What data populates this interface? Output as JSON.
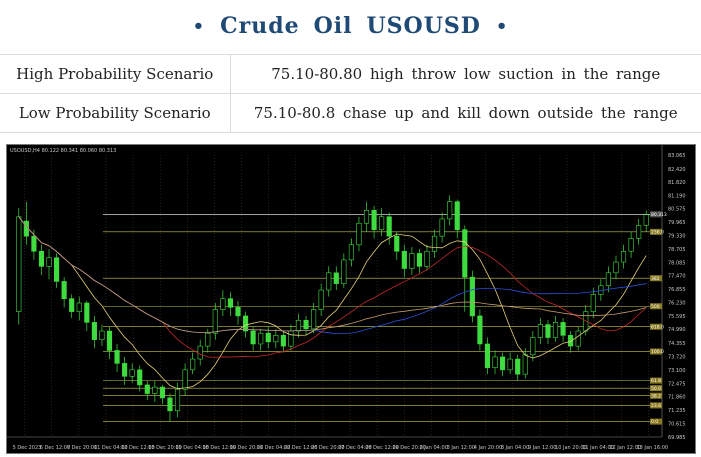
{
  "title": {
    "bullet_left": "•",
    "word1": "Crude",
    "word2": "Oil",
    "word3": "USOUSD",
    "bullet_right": "•"
  },
  "scenarios": [
    {
      "label": "High Probability Scenario",
      "value": "75.10-80.80 high throw low suction in the range"
    },
    {
      "label": "Low Probability Scenario",
      "value": "75.10-80.8 chase up and kill down outside the range"
    }
  ],
  "chart_data": {
    "type": "candlestick",
    "symbol_header": "USOUSD,H4  80.122 80.341 80.060 80.313",
    "price_axis": [
      "83.065",
      "82.420",
      "81.820",
      "81.190",
      "80.575",
      "79.965",
      "79.330",
      "78.705",
      "78.085",
      "77.470",
      "76.855",
      "76.230",
      "75.595",
      "74.990",
      "74.355",
      "73.720",
      "73.100",
      "72.475",
      "71.860",
      "71.235",
      "70.615",
      "69.985"
    ],
    "time_axis": [
      "5 Dec 2023",
      "6 Dec 12:00",
      "7 Dec 20:00",
      "11 Dec 04:00",
      "12 Dec 12:00",
      "13 Dec 20:00",
      "15 Dec 04:00",
      "18 Dec 12:00",
      "19 Dec 20:00",
      "21 Dec 04:00",
      "22 Dec 12:00",
      "26 Dec 20:00",
      "27 Dec 04:00",
      "28 Dec 12:00",
      "29 Dec 20:00",
      "2 Jan 04:00",
      "3 Jan 12:00",
      "4 Jan 20:00",
      "8 Jan 04:00",
      "9 Jan 12:00",
      "10 Jan 20:00",
      "11 Jan 04:00",
      "12 Jan 12:00",
      "13 Jan 16:00"
    ],
    "y_range": [
      69.985,
      83.065
    ],
    "current_price": "80.313",
    "levels": [
      {
        "price": 80.313,
        "label": "80.313",
        "color": "#ffffff"
      },
      {
        "price": 79.5,
        "label": "236.0",
        "color": "#c8c850"
      },
      {
        "price": 77.35,
        "label": "382",
        "color": "#c8c850"
      },
      {
        "price": 76.05,
        "label": "500",
        "color": "#c8c850"
      },
      {
        "price": 75.1,
        "label": "618.0",
        "color": "#c8c850"
      },
      {
        "price": 73.95,
        "label": "100.0",
        "color": "#c8c850"
      },
      {
        "price": 72.6,
        "label": "61.8",
        "color": "#c8c850"
      },
      {
        "price": 72.25,
        "label": "50.0",
        "color": "#c8c850"
      },
      {
        "price": 71.9,
        "label": "38.2",
        "color": "#c8c850"
      },
      {
        "price": 71.45,
        "label": "23.6",
        "color": "#c8c850"
      },
      {
        "price": 70.7,
        "label": "0.0",
        "color": "#c8c850"
      }
    ],
    "candles": [
      [
        75.8,
        80.2,
        75.2,
        80.6
      ],
      [
        80.0,
        79.3,
        78.9,
        80.9
      ],
      [
        79.3,
        78.6,
        78.2,
        79.6
      ],
      [
        78.6,
        77.9,
        77.5,
        78.9
      ],
      [
        77.9,
        78.3,
        77.3,
        78.7
      ],
      [
        78.3,
        77.2,
        76.9,
        78.5
      ],
      [
        77.2,
        76.4,
        76.0,
        77.4
      ],
      [
        76.4,
        75.8,
        75.5,
        76.6
      ],
      [
        75.8,
        76.2,
        75.4,
        76.5
      ],
      [
        76.2,
        75.3,
        74.9,
        76.3
      ],
      [
        75.3,
        74.5,
        74.1,
        75.6
      ],
      [
        74.5,
        74.9,
        74.2,
        75.2
      ],
      [
        74.9,
        74.0,
        73.6,
        75.1
      ],
      [
        74.0,
        73.4,
        73.0,
        74.3
      ],
      [
        73.4,
        72.8,
        72.4,
        73.7
      ],
      [
        72.8,
        73.1,
        72.5,
        73.4
      ],
      [
        73.1,
        72.4,
        72.1,
        73.3
      ],
      [
        72.4,
        72.0,
        71.7,
        72.6
      ],
      [
        72.0,
        72.3,
        71.6,
        72.6
      ],
      [
        72.3,
        71.8,
        71.5,
        72.4
      ],
      [
        71.8,
        71.2,
        70.7,
        72.0
      ],
      [
        71.2,
        72.2,
        70.9,
        72.5
      ],
      [
        72.2,
        73.1,
        71.9,
        73.4
      ],
      [
        73.1,
        73.6,
        72.9,
        73.9
      ],
      [
        73.6,
        74.2,
        73.3,
        74.5
      ],
      [
        74.2,
        74.8,
        73.9,
        75.0
      ],
      [
        74.8,
        75.9,
        74.5,
        76.2
      ],
      [
        75.9,
        76.4,
        75.6,
        76.8
      ],
      [
        76.4,
        76.0,
        75.6,
        76.7
      ],
      [
        76.0,
        75.6,
        75.2,
        76.3
      ],
      [
        75.6,
        74.9,
        74.6,
        75.8
      ],
      [
        74.9,
        74.3,
        74.0,
        75.1
      ],
      [
        74.3,
        74.8,
        74.0,
        75.0
      ],
      [
        74.8,
        74.4,
        74.1,
        75.1
      ],
      [
        74.4,
        74.7,
        74.1,
        75.0
      ],
      [
        74.7,
        74.2,
        73.9,
        74.9
      ],
      [
        74.2,
        74.9,
        74.0,
        75.2
      ],
      [
        74.9,
        75.4,
        74.6,
        75.7
      ],
      [
        75.4,
        75.0,
        74.7,
        75.6
      ],
      [
        75.0,
        75.9,
        74.8,
        76.2
      ],
      [
        75.9,
        76.8,
        75.6,
        77.1
      ],
      [
        76.8,
        77.6,
        76.5,
        77.9
      ],
      [
        77.6,
        77.1,
        76.8,
        77.9
      ],
      [
        77.1,
        78.2,
        76.9,
        78.5
      ],
      [
        78.2,
        78.9,
        77.9,
        79.2
      ],
      [
        78.9,
        79.9,
        78.6,
        80.2
      ],
      [
        79.9,
        80.5,
        79.5,
        80.9
      ],
      [
        80.5,
        79.6,
        79.2,
        80.7
      ],
      [
        79.6,
        80.2,
        79.3,
        80.6
      ],
      [
        80.2,
        79.3,
        78.9,
        80.4
      ],
      [
        79.3,
        78.6,
        78.2,
        79.5
      ],
      [
        78.6,
        77.8,
        77.4,
        78.9
      ],
      [
        77.8,
        78.5,
        77.5,
        78.8
      ],
      [
        78.5,
        77.9,
        77.6,
        78.7
      ],
      [
        77.9,
        78.6,
        77.7,
        78.9
      ],
      [
        78.6,
        79.3,
        78.3,
        79.6
      ],
      [
        79.3,
        80.1,
        79.0,
        80.4
      ],
      [
        80.1,
        80.9,
        79.8,
        81.2
      ],
      [
        80.9,
        79.6,
        79.2,
        81.0
      ],
      [
        79.6,
        77.4,
        75.8,
        79.8
      ],
      [
        77.4,
        75.6,
        75.3,
        77.7
      ],
      [
        75.6,
        74.3,
        74.0,
        75.9
      ],
      [
        74.3,
        73.2,
        72.9,
        74.6
      ],
      [
        73.2,
        73.7,
        72.9,
        74.0
      ],
      [
        73.7,
        73.1,
        72.8,
        73.9
      ],
      [
        73.1,
        73.6,
        72.9,
        73.9
      ],
      [
        73.6,
        72.9,
        72.6,
        73.8
      ],
      [
        72.9,
        73.8,
        72.7,
        74.1
      ],
      [
        73.8,
        74.6,
        73.5,
        74.9
      ],
      [
        74.6,
        75.2,
        74.3,
        75.5
      ],
      [
        75.2,
        74.6,
        74.3,
        75.4
      ],
      [
        74.6,
        75.3,
        74.4,
        75.6
      ],
      [
        75.3,
        74.7,
        74.4,
        75.5
      ],
      [
        74.7,
        74.2,
        73.9,
        74.9
      ],
      [
        74.2,
        74.9,
        74.0,
        75.1
      ],
      [
        74.9,
        75.8,
        74.7,
        76.1
      ],
      [
        75.8,
        76.6,
        75.5,
        76.9
      ],
      [
        76.6,
        77.0,
        76.3,
        77.3
      ],
      [
        77.0,
        77.6,
        76.7,
        77.9
      ],
      [
        77.6,
        78.1,
        77.3,
        78.4
      ],
      [
        78.1,
        78.6,
        77.8,
        78.9
      ],
      [
        78.6,
        79.2,
        78.3,
        79.5
      ],
      [
        79.2,
        79.8,
        78.9,
        80.1
      ],
      [
        79.8,
        80.3,
        79.5,
        80.5
      ]
    ]
  }
}
